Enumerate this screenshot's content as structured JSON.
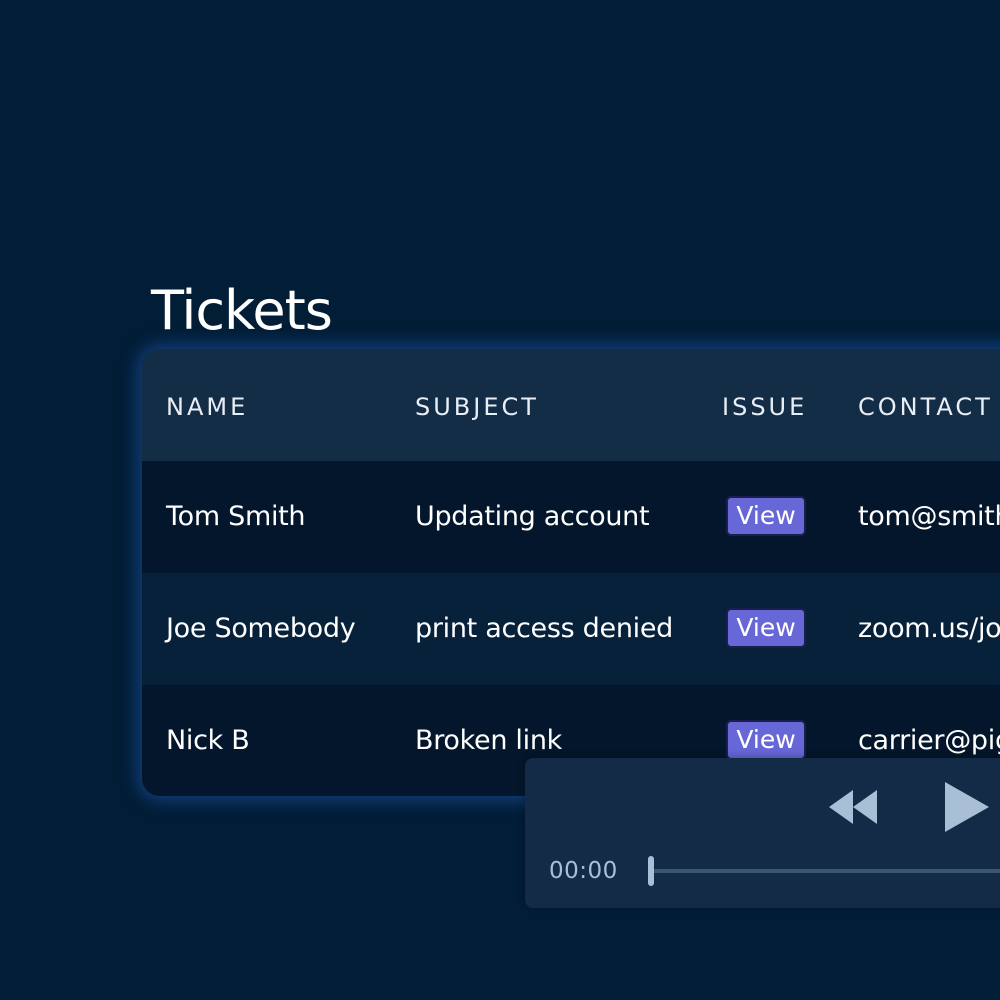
{
  "page": {
    "title": "Tickets"
  },
  "table": {
    "columns": [
      "NAME",
      "SUBJECT",
      "ISSUE",
      "CONTACT"
    ],
    "rows": [
      {
        "name": "Tom Smith",
        "subject": "Updating account",
        "issue": "View",
        "contact": "tom@smith"
      },
      {
        "name": "Joe Somebody",
        "subject": "print access denied",
        "issue": "View",
        "contact": "zoom.us/jo"
      },
      {
        "name": "Nick B",
        "subject": "Broken link",
        "issue": "View",
        "contact": "carrier@pig"
      }
    ]
  },
  "player": {
    "time": "00:00",
    "progress": 0,
    "rewind_icon": "rewind-icon",
    "play_icon": "play-icon"
  },
  "colors": {
    "background": "#021d36",
    "header_row": "#142d47",
    "view_button": "#6767d8",
    "player_bg": "#132b46",
    "glow": "#286edc"
  }
}
